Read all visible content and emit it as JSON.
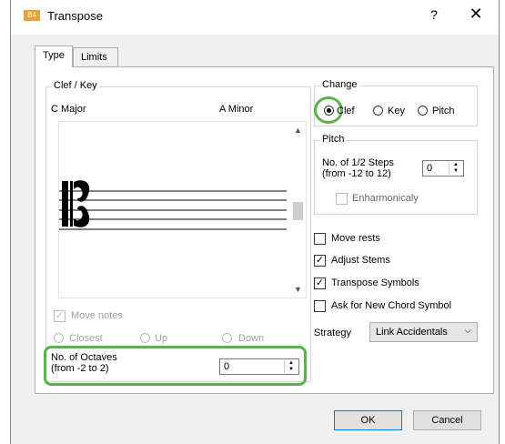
{
  "window": {
    "title": "Transpose",
    "app_icon_text": "B4",
    "help_label": "?",
    "close_label": "✕"
  },
  "tabs": [
    {
      "label": "Type",
      "active": true
    },
    {
      "label": "Limits",
      "active": false
    }
  ],
  "clef_key": {
    "group_title": "Clef / Key",
    "key_left": "C Major",
    "key_right": "A Minor"
  },
  "move_notes": {
    "label": "Move notes",
    "checked": true,
    "enabled": false
  },
  "direction": {
    "options": [
      "Closest",
      "Up",
      "Down"
    ],
    "selected": null
  },
  "octaves": {
    "label_line1": "No. of Octaves",
    "label_line2": "(from -2 to 2)",
    "value": "0"
  },
  "change": {
    "group_title": "Change",
    "options": [
      "Clef",
      "Key",
      "Pitch"
    ],
    "selected": "Clef"
  },
  "pitch": {
    "group_title": "Pitch",
    "steps_line1": "No. of 1/2 Steps",
    "steps_line2": "(from -12 to 12)",
    "steps_value": "0",
    "enharmonic_label": "Enharmonicaly",
    "enharmonic_checked": false
  },
  "options": [
    {
      "label": "Move rests",
      "checked": false
    },
    {
      "label": "Adjust Stems",
      "checked": true
    },
    {
      "label": "Transpose Symbols",
      "checked": true
    },
    {
      "label": "Ask for New Chord Symbol",
      "checked": false
    }
  ],
  "strategy": {
    "label": "Strategy",
    "value": "Link Accidentals"
  },
  "buttons": {
    "ok": "OK",
    "cancel": "Cancel"
  },
  "colors": {
    "highlight": "#5ab24a",
    "default_button_border": "#0078d7"
  }
}
